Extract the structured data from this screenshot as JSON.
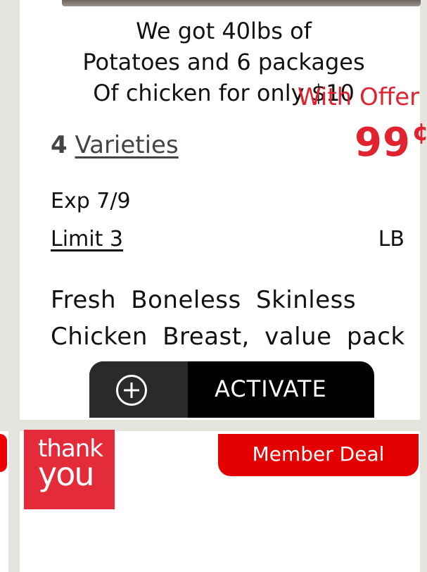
{
  "caption": {
    "line1": "We got 40lbs of",
    "line2": "Potatoes and 6 packages",
    "line3": "Of chicken for only $10"
  },
  "offer": {
    "with_offer_label": "With Offer",
    "price_main": "99",
    "price_cent": "¢"
  },
  "varieties": {
    "count": "4",
    "label": "Varieties"
  },
  "expiry": "Exp 7/9",
  "limit": "Limit 3",
  "unit": "LB",
  "product_name": "Fresh Boneless Skinless Chicken Breast, value pack",
  "activate_button": {
    "label": "ACTIVATE",
    "icon": "plus-circle-icon"
  },
  "next_card": {
    "ribbon_line1": "thank",
    "ribbon_line2": "you",
    "badge": "Member Deal"
  },
  "colors": {
    "accent_red": "#e0232f",
    "badge_red": "#e50000",
    "button_bg": "#000000"
  }
}
